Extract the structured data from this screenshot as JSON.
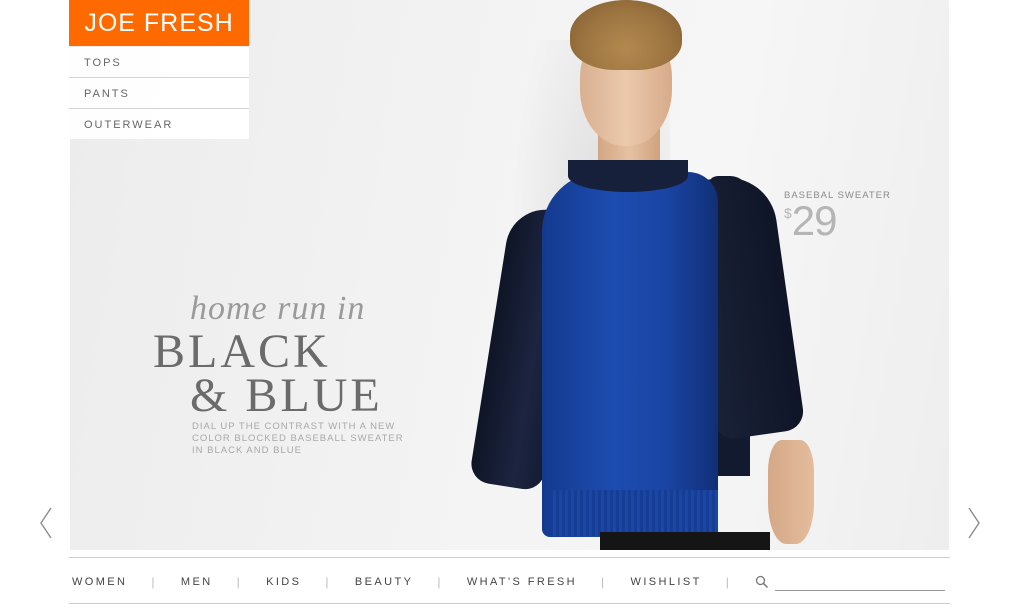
{
  "brand": {
    "logo_text": "JOE FRESH",
    "accent_color": "#ff6a00"
  },
  "category_menu": {
    "items": [
      {
        "label": "TOPS"
      },
      {
        "label": "PANTS"
      },
      {
        "label": "OUTERWEAR"
      }
    ]
  },
  "hero": {
    "headline_small": "home run in",
    "headline_line1": "BLACK",
    "headline_line2": "& BLUE",
    "subtitle": "DIAL UP THE CONTRAST WITH A NEW COLOR BLOCKED BASEBALL SWEATER IN BLACK AND BLUE",
    "product_name": "BASEBAL SWEATER",
    "currency_symbol": "$",
    "price": "29",
    "image_description": "Model wearing a blue and black color-blocked crew-neck sweater"
  },
  "carousel": {
    "prev_icon": "chevron-left-icon",
    "next_icon": "chevron-right-icon"
  },
  "nav": {
    "items": [
      {
        "label": "WOMEN"
      },
      {
        "label": "MEN"
      },
      {
        "label": "KIDS"
      },
      {
        "label": "BEAUTY"
      },
      {
        "label": "WHAT'S FRESH"
      },
      {
        "label": "WISHLIST"
      }
    ],
    "separator": "|",
    "search_icon": "search-icon",
    "search_value": ""
  }
}
